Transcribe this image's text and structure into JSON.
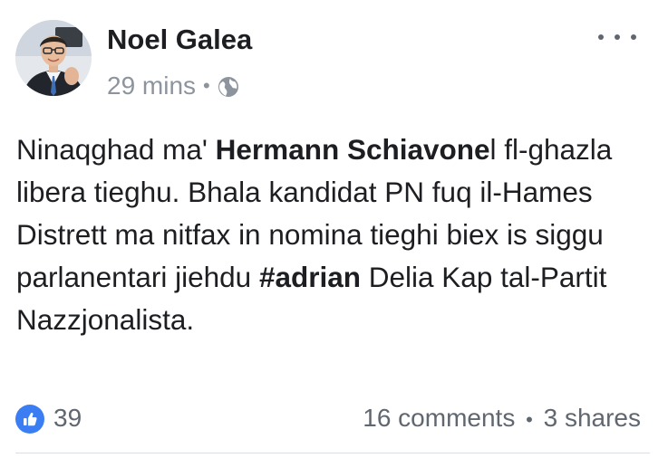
{
  "post": {
    "author": "Noel Galea",
    "time": "29 mins",
    "meta_separator": "•",
    "privacy_icon": "globe-icon",
    "more_icon": "more-options-icon",
    "text": {
      "part1": "Ninaqghad ma' ",
      "mention": "Hermann Schiavone",
      "part2": "l fl-ghazla libera tieghu. Bhala kandidat PN fuq il-Hames Distrett ma nitfax in nomina tieghi biex is siggu parlanentari jiehdu ",
      "hashtag": "#adrian",
      "part3": " Delia Kap tal-Partit Nazzjonalista."
    },
    "reactions": {
      "icon": "thumbs-up-icon",
      "count": "39"
    },
    "comments": "16 comments",
    "engagement_separator": "•",
    "shares": "3 shares"
  },
  "colors": {
    "like_blue": "#3b7ef3",
    "meta_gray": "#8d949e",
    "text": "#1c1e21"
  }
}
